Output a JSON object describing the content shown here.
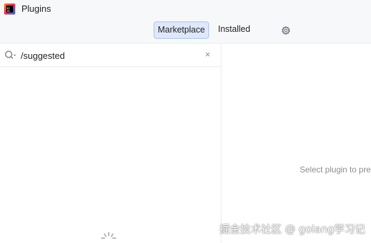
{
  "window": {
    "title": "Plugins",
    "app_icon": "intellij-app-icon"
  },
  "tabs": [
    {
      "label": "Marketplace",
      "active": true
    },
    {
      "label": "Installed",
      "active": false
    }
  ],
  "settings": {
    "icon": "gear-icon"
  },
  "search": {
    "value": "/suggested",
    "icon": "search-options-icon",
    "clear_icon": "close-icon",
    "clear_glyph": "×"
  },
  "plugin_list": {
    "loading": true
  },
  "details": {
    "empty_message": "Select plugin to preview details"
  },
  "watermark": {
    "text": "掘金技术社区 @ golang学习记"
  },
  "colors": {
    "accent_bg": "#dfe8fb",
    "accent_border": "#a8c3f0",
    "panel_bg": "#f7f8fa",
    "divider": "#ebecf0"
  }
}
